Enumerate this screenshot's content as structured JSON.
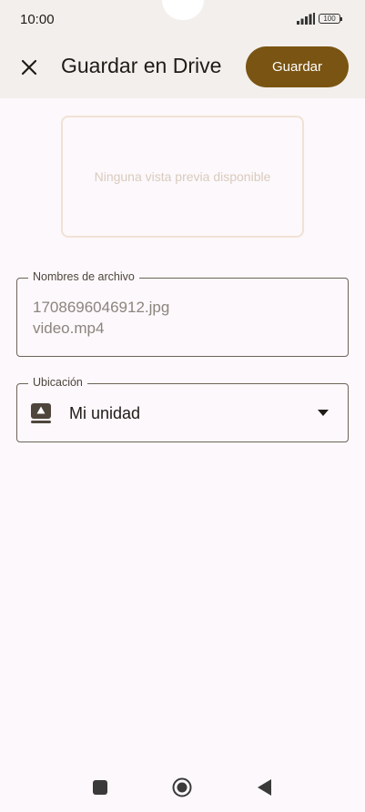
{
  "status_bar": {
    "time": "10:00",
    "battery": "100"
  },
  "app_bar": {
    "title": "Guardar en Drive",
    "save_label": "Guardar"
  },
  "preview": {
    "text": "Ninguna vista previa disponible"
  },
  "file_names": {
    "label": "Nombres de archivo",
    "items": [
      "1708696046912.jpg",
      "video.mp4"
    ]
  },
  "location": {
    "label": "Ubicación",
    "value": "Mi unidad"
  },
  "icons": {
    "close": "close-icon",
    "drive": "drive-icon",
    "dropdown": "arrow-drop-down-icon",
    "nav_back": "back-icon",
    "nav_home": "home-icon",
    "nav_recents": "recents-icon"
  },
  "colors": {
    "accent": "#7a5412",
    "background": "#fcf8fb",
    "app_bar": "#f3efec"
  }
}
